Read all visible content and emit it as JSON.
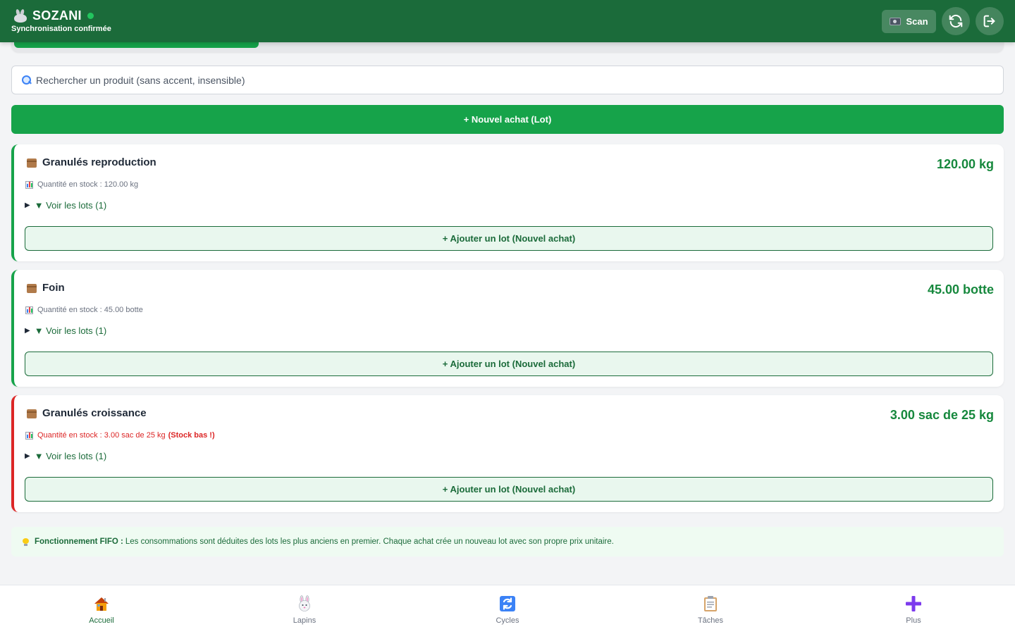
{
  "header": {
    "app_name": "SOZANI",
    "sync_status": "Synchronisation confirmée",
    "scan_label": "Scan"
  },
  "search": {
    "placeholder": "Rechercher un produit (sans accent, insensible)"
  },
  "new_purchase_label": "+ Nouvel achat (Lot)",
  "products": [
    {
      "name": "Granulés reproduction",
      "quantity": "120.00 kg",
      "stock_text": "Quantité en stock : 120.00 kg",
      "stock_warning": "",
      "lots_label": "▼ Voir les lots (1)",
      "add_lot_label": "+ Ajouter un lot (Nouvel achat)",
      "low_stock": false
    },
    {
      "name": "Foin",
      "quantity": "45.00 botte",
      "stock_text": "Quantité en stock : 45.00 botte",
      "stock_warning": "",
      "lots_label": "▼ Voir les lots (1)",
      "add_lot_label": "+ Ajouter un lot (Nouvel achat)",
      "low_stock": false
    },
    {
      "name": "Granulés croissance",
      "quantity": "3.00 sac de 25 kg",
      "stock_text": "Quantité en stock : 3.00 sac de 25 kg",
      "stock_warning": "(Stock bas !)",
      "lots_label": "▼ Voir les lots (1)",
      "add_lot_label": "+ Ajouter un lot (Nouvel achat)",
      "low_stock": true
    }
  ],
  "fifo": {
    "title": "Fonctionnement FIFO :",
    "text": "Les consommations sont déduites des lots les plus anciens en premier. Chaque achat crée un nouveau lot avec son propre prix unitaire."
  },
  "bottom_nav": [
    {
      "label": "Accueil",
      "icon": "house-icon",
      "active": true
    },
    {
      "label": "Lapins",
      "icon": "rabbit-icon",
      "active": false
    },
    {
      "label": "Cycles",
      "icon": "cycle-icon",
      "active": false
    },
    {
      "label": "Tâches",
      "icon": "clipboard-icon",
      "active": false
    },
    {
      "label": "Plus",
      "icon": "plus-icon",
      "active": false
    }
  ],
  "colors": {
    "header": "#1b6b3a",
    "primary": "#16a34a",
    "danger": "#dc2626"
  }
}
